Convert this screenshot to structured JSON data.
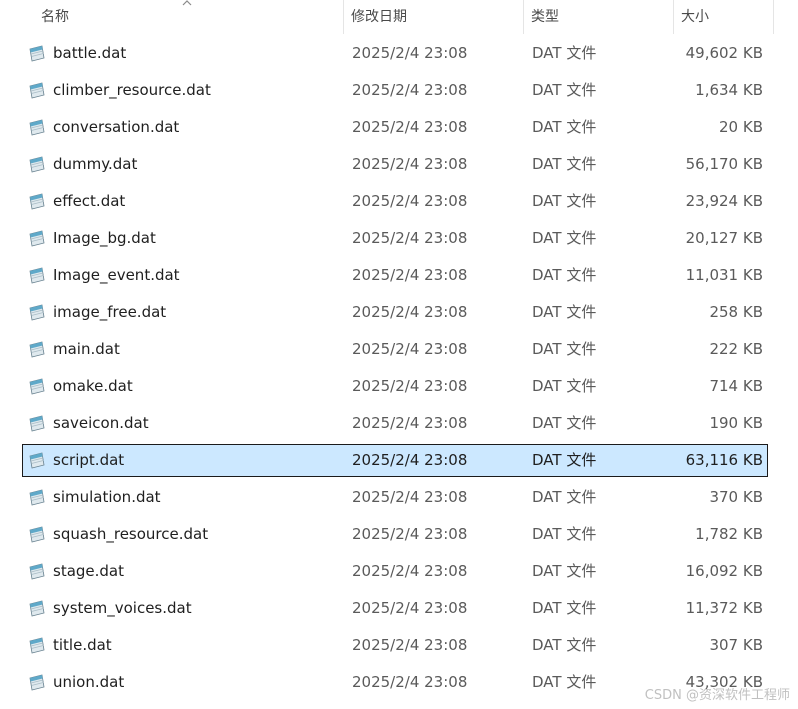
{
  "header": {
    "columns": [
      {
        "label": "名称"
      },
      {
        "label": "修改日期"
      },
      {
        "label": "类型"
      },
      {
        "label": "大小"
      }
    ]
  },
  "files": [
    {
      "name": "battle.dat",
      "date": "2025/2/4 23:08",
      "type": "DAT 文件",
      "size": "49,602 KB"
    },
    {
      "name": "climber_resource.dat",
      "date": "2025/2/4 23:08",
      "type": "DAT 文件",
      "size": "1,634 KB"
    },
    {
      "name": "conversation.dat",
      "date": "2025/2/4 23:08",
      "type": "DAT 文件",
      "size": "20 KB"
    },
    {
      "name": "dummy.dat",
      "date": "2025/2/4 23:08",
      "type": "DAT 文件",
      "size": "56,170 KB"
    },
    {
      "name": "effect.dat",
      "date": "2025/2/4 23:08",
      "type": "DAT 文件",
      "size": "23,924 KB"
    },
    {
      "name": "Image_bg.dat",
      "date": "2025/2/4 23:08",
      "type": "DAT 文件",
      "size": "20,127 KB"
    },
    {
      "name": "Image_event.dat",
      "date": "2025/2/4 23:08",
      "type": "DAT 文件",
      "size": "11,031 KB"
    },
    {
      "name": "image_free.dat",
      "date": "2025/2/4 23:08",
      "type": "DAT 文件",
      "size": "258 KB"
    },
    {
      "name": "main.dat",
      "date": "2025/2/4 23:08",
      "type": "DAT 文件",
      "size": "222 KB"
    },
    {
      "name": "omake.dat",
      "date": "2025/2/4 23:08",
      "type": "DAT 文件",
      "size": "714 KB"
    },
    {
      "name": "saveicon.dat",
      "date": "2025/2/4 23:08",
      "type": "DAT 文件",
      "size": "190 KB"
    },
    {
      "name": "script.dat",
      "date": "2025/2/4 23:08",
      "type": "DAT 文件",
      "size": "63,116 KB",
      "selected": true
    },
    {
      "name": "simulation.dat",
      "date": "2025/2/4 23:08",
      "type": "DAT 文件",
      "size": "370 KB"
    },
    {
      "name": "squash_resource.dat",
      "date": "2025/2/4 23:08",
      "type": "DAT 文件",
      "size": "1,782 KB"
    },
    {
      "name": "stage.dat",
      "date": "2025/2/4 23:08",
      "type": "DAT 文件",
      "size": "16,092 KB"
    },
    {
      "name": "system_voices.dat",
      "date": "2025/2/4 23:08",
      "type": "DAT 文件",
      "size": "11,372 KB"
    },
    {
      "name": "title.dat",
      "date": "2025/2/4 23:08",
      "type": "DAT 文件",
      "size": "307 KB"
    },
    {
      "name": "union.dat",
      "date": "2025/2/4 23:08",
      "type": "DAT 文件",
      "size": "43,302 KB"
    }
  ],
  "file_icon": "dat-file-icon",
  "watermark": "CSDN @资深软件工程师",
  "colors": {
    "selection_bg": "#cce8ff",
    "selection_border": "#1b1b1b"
  }
}
